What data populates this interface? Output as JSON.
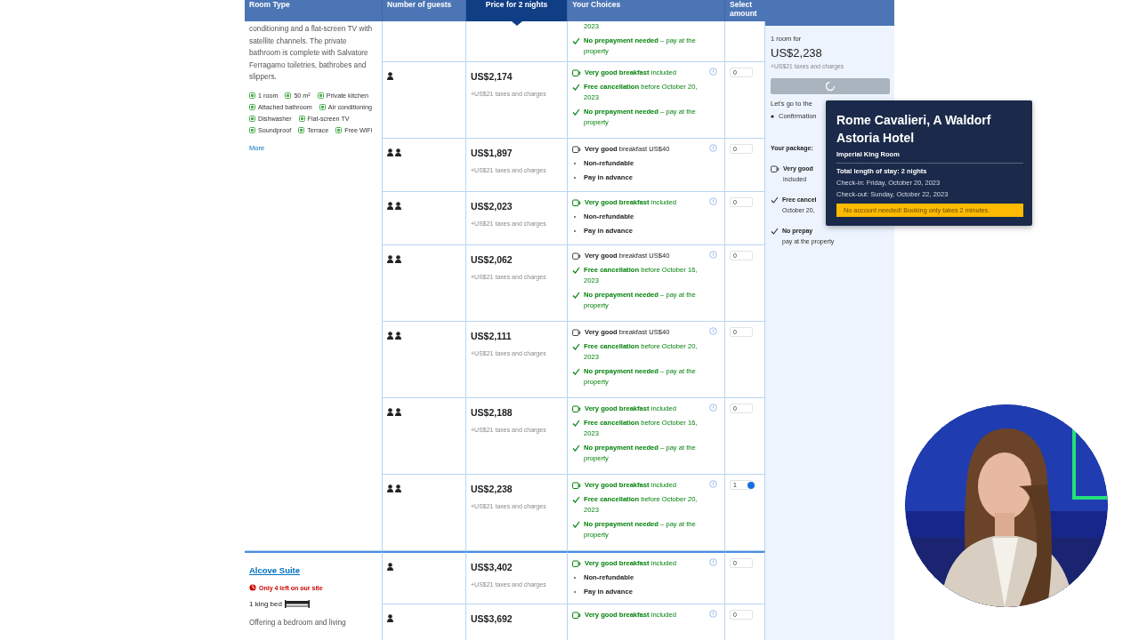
{
  "table": {
    "columns": [
      {
        "label": "Room Type",
        "selected": false
      },
      {
        "label": "Number of guests",
        "selected": false
      },
      {
        "label": "Price for 2 nights",
        "selected": true
      },
      {
        "label": "Your Choices",
        "selected": false
      },
      {
        "label": "Select amount",
        "selected": false
      }
    ]
  },
  "room_types": [
    {
      "description": "conditioning and a flat-screen TV with satellite channels. The private bathroom is complete with Salvatore Ferragamo toiletries, bathrobes and slippers.",
      "facilities": [
        "1 room",
        "50 m²",
        "Private kitchen",
        "Attached bathroom",
        "Air conditioning",
        "Dishwasher",
        "Flat-screen TV",
        "Soundproof",
        "Terrace",
        "Free WiFi"
      ],
      "more_link": "More",
      "rows": [
        {
          "kind": "continued",
          "choices": [
            {
              "kind": "continuation",
              "text": "2023"
            },
            {
              "kind": "no_prepayment",
              "text": "**No prepayment needed** – pay at the property"
            }
          ]
        },
        {
          "kind": "single_guest",
          "price": "US$2,174",
          "taxes": "+US$21 taxes and charges",
          "choices": [
            {
              "kind": "breakfast_included",
              "text": "**Very good breakfast** included"
            },
            {
              "kind": "free_cancellation",
              "text": "**Free cancellation** before October 20, 2023"
            },
            {
              "kind": "no_prepayment",
              "text": "**No prepayment needed** – pay at the property"
            }
          ],
          "amount": "0",
          "selected": false
        },
        {
          "kind": "two_guests",
          "price": "US$1,897",
          "taxes": "+US$21 taxes and charges",
          "choices": [
            {
              "kind": "breakfast_extra",
              "text": "**Very good** breakfast US$40"
            },
            {
              "kind": "condition",
              "text": "Non-refundable"
            },
            {
              "kind": "condition",
              "text": "Pay in advance"
            }
          ],
          "amount": "0",
          "selected": false
        },
        {
          "kind": "two_guests",
          "price": "US$2,023",
          "taxes": "+US$21 taxes and charges",
          "choices": [
            {
              "kind": "breakfast_included",
              "text": "**Very good breakfast** included"
            },
            {
              "kind": "condition",
              "text": "Non-refundable"
            },
            {
              "kind": "condition",
              "text": "Pay in advance"
            }
          ],
          "amount": "0",
          "selected": false
        },
        {
          "kind": "two_guests",
          "price": "US$2,062",
          "taxes": "+US$21 taxes and charges",
          "choices": [
            {
              "kind": "breakfast_extra",
              "text": "**Very good** breakfast US$40"
            },
            {
              "kind": "free_cancellation",
              "text": "**Free cancellation** before October 16, 2023"
            },
            {
              "kind": "no_prepayment",
              "text": "**No prepayment needed** – pay at the property"
            }
          ],
          "amount": "0",
          "selected": false
        },
        {
          "kind": "two_guests",
          "price": "US$2,111",
          "taxes": "+US$21 taxes and charges",
          "choices": [
            {
              "kind": "breakfast_extra",
              "text": "**Very good** breakfast US$40"
            },
            {
              "kind": "free_cancellation",
              "text": "**Free cancellation** before October 20, 2023"
            },
            {
              "kind": "no_prepayment",
              "text": "**No prepayment needed** – pay at the property"
            }
          ],
          "amount": "0",
          "selected": false
        },
        {
          "kind": "two_guests",
          "price": "US$2,188",
          "taxes": "+US$21 taxes and charges",
          "choices": [
            {
              "kind": "breakfast_included",
              "text": "**Very good breakfast** included"
            },
            {
              "kind": "free_cancellation",
              "text": "**Free cancellation** before October 16, 2023"
            },
            {
              "kind": "no_prepayment",
              "text": "**No prepayment needed** – pay at the property"
            }
          ],
          "amount": "0",
          "selected": false
        },
        {
          "kind": "two_guests",
          "price": "US$2,238",
          "taxes": "+US$21 taxes and charges",
          "choices": [
            {
              "kind": "breakfast_included",
              "text": "**Very good breakfast** included"
            },
            {
              "kind": "free_cancellation",
              "text": "**Free cancellation** before October 20, 2023"
            },
            {
              "kind": "no_prepayment",
              "text": "**No prepayment needed** – pay at the property"
            }
          ],
          "amount": "1",
          "selected": true
        }
      ]
    },
    {
      "name": "Alcove Suite",
      "scarcity": "Only 4 left on our site",
      "bed": "1 king bed",
      "description": "Offering a bedroom and living",
      "rows": [
        {
          "kind": "single_guest",
          "price": "US$3,402",
          "taxes": "+US$21 taxes and charges",
          "choices": [
            {
              "kind": "breakfast_included",
              "text": "**Very good breakfast** included"
            },
            {
              "kind": "condition",
              "text": "Non-refundable"
            },
            {
              "kind": "condition",
              "text": "Pay in advance"
            }
          ],
          "amount": "0",
          "selected": false
        },
        {
          "kind": "single_guest",
          "price": "US$3,692",
          "choices": [
            {
              "kind": "breakfast_included",
              "text": "**Very good breakfast** included"
            }
          ],
          "amount": "0",
          "selected": false
        }
      ]
    }
  ],
  "summary": {
    "rooms_label": "1 room for",
    "total": "US$2,238",
    "taxes": "+US$21 taxes and charges",
    "next_step": "Let's go to the",
    "steps": [
      "Confirmation"
    ],
    "package_label": "Your package:",
    "package": [
      {
        "kind": "breakfast",
        "lines": [
          "Very good",
          "included"
        ]
      },
      {
        "kind": "check",
        "lines": [
          "Free cancel",
          "October 20,"
        ]
      },
      {
        "kind": "check",
        "lines": [
          "No prepay",
          "pay at the property"
        ]
      }
    ]
  },
  "tooltip": {
    "hotel": "Rome Cavalieri, A Waldorf Astoria Hotel",
    "room": "Imperial King Room",
    "stay": "Total length of stay: 2 nights",
    "check_in": "Check-in: Friday, October 20, 2023",
    "check_out": "Check-out: Sunday, October 22, 2023",
    "notice": "No account needed! Booking only takes 2 minutes."
  }
}
